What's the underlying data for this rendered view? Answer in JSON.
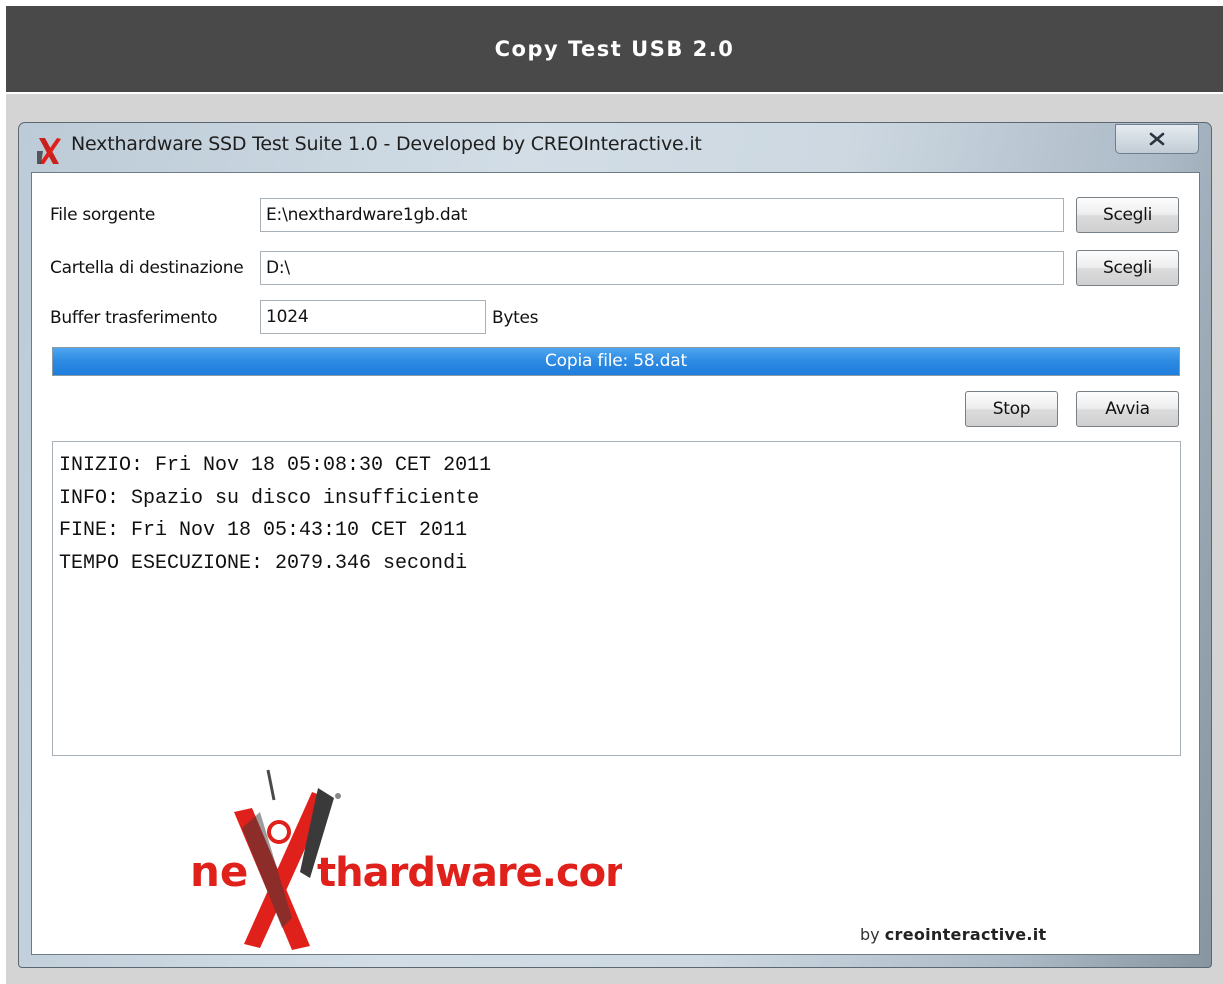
{
  "page": {
    "header_title": "Copy Test USB 2.0"
  },
  "window": {
    "title": "Nexthardware SSD Test Suite 1.0 - Developed by CREOInteractive.it",
    "close_icon": "close-x-icon",
    "app_icon": "red-x-logo-icon"
  },
  "form": {
    "source_label": "File sorgente",
    "source_value": "E:\\nexthardware1gb.dat",
    "source_button": "Scegli",
    "dest_label": "Cartella di destinazione",
    "dest_value": "D:\\",
    "dest_button": "Scegli",
    "buffer_label": "Buffer trasferimento",
    "buffer_value": "1024",
    "buffer_unit": "Bytes"
  },
  "progress": {
    "text": "Copia file: 58.dat",
    "fraction": 1.0,
    "color": "#2c8ae2"
  },
  "actions": {
    "stop_label": "Stop",
    "start_label": "Avvia"
  },
  "log": {
    "lines": [
      "INIZIO: Fri Nov 18 05:08:30 CET 2011",
      "INFO: Spazio su disco insufficiente",
      "FINE: Fri Nov 18 05:43:10 CET 2011",
      "TEMPO ESECUZIONE: 2079.346 secondi"
    ]
  },
  "branding": {
    "logo_text_left": "ne",
    "logo_text_right": "thardware.com",
    "logo_color_red": "#e0201b",
    "logo_color_dark": "#3a3a3a",
    "byline_prefix": "by ",
    "byline_site": "creointeractive.it"
  }
}
